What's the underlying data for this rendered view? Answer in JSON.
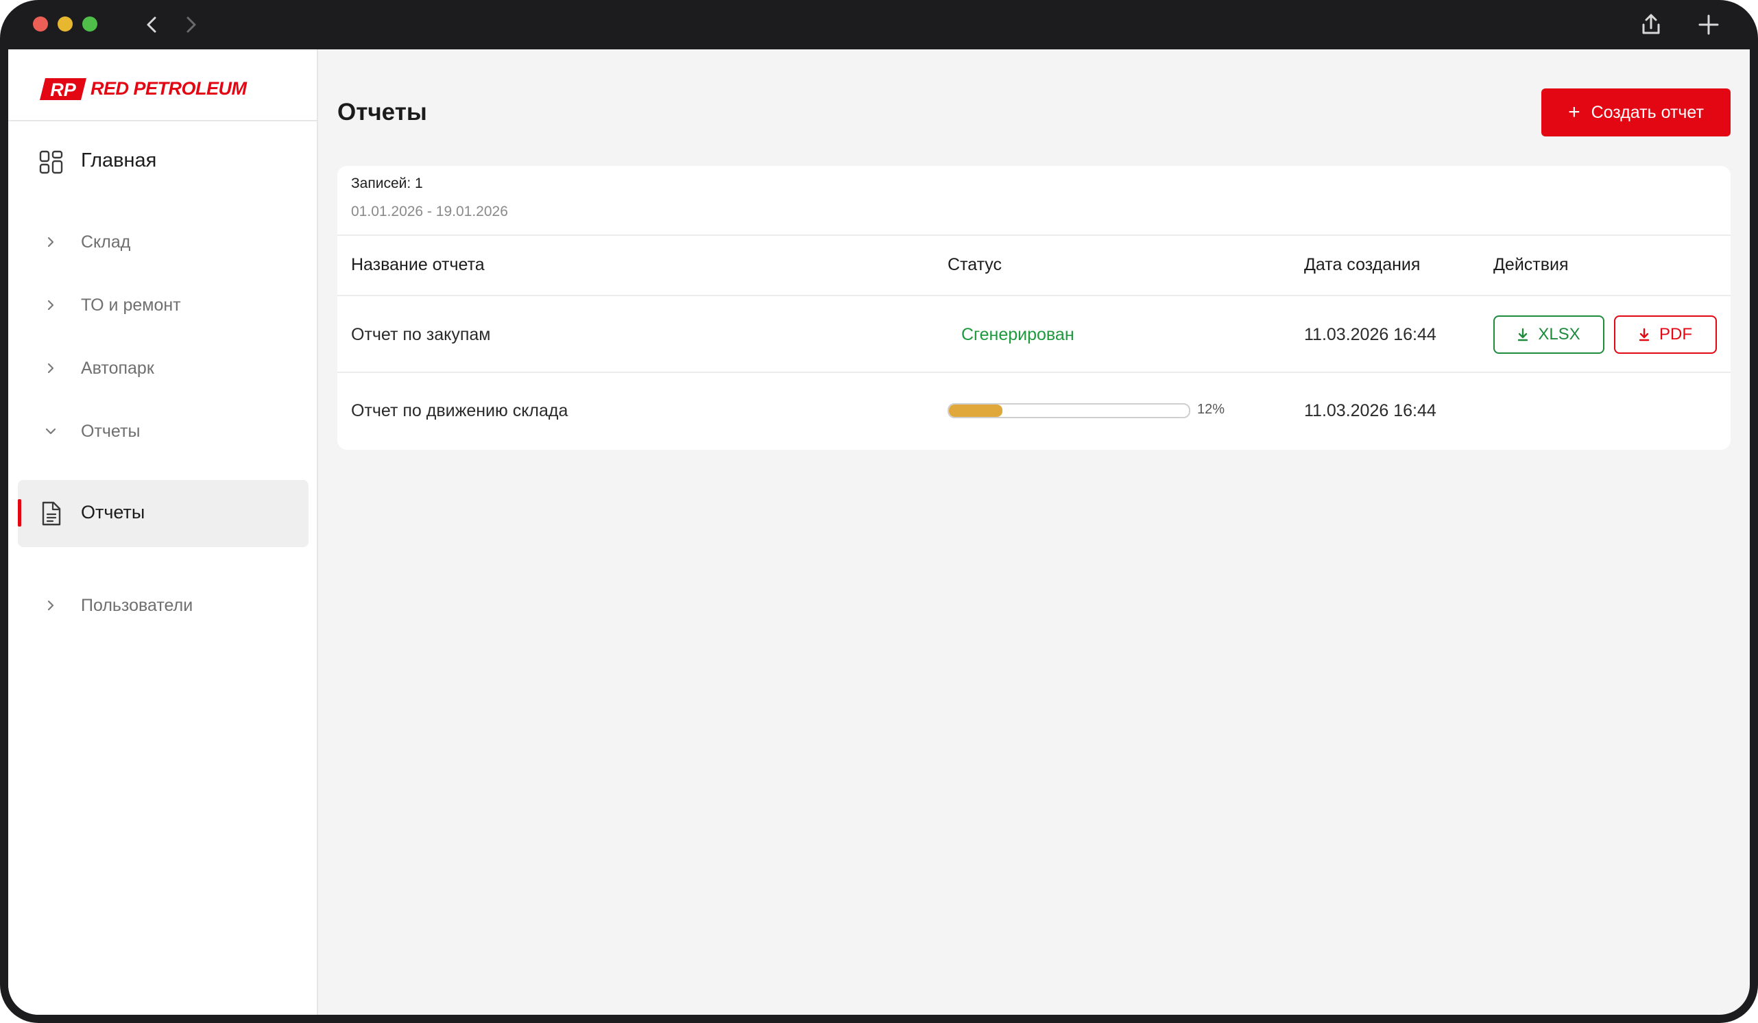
{
  "window": {
    "controls": [
      "close",
      "minimize",
      "maximize"
    ],
    "nav_icons": [
      "back-icon",
      "forward-icon"
    ],
    "right_icons": [
      "share-icon",
      "new-tab-icon"
    ]
  },
  "brand": {
    "logo_mark": "RP",
    "logo_text": "RED PETROLEUM",
    "color": "#e30613"
  },
  "sidebar": {
    "home": {
      "label": "Главная",
      "icon": "grid-icon"
    },
    "items": [
      {
        "label": "Склад",
        "icon": "chevron-right-icon"
      },
      {
        "label": "ТО и ремонт",
        "icon": "chevron-right-icon"
      },
      {
        "label": "Автопарк",
        "icon": "chevron-right-icon"
      },
      {
        "label": "Отчеты",
        "icon": "chevron-down-icon",
        "expanded": true
      },
      {
        "label": "Пользователи",
        "icon": "chevron-right-icon"
      }
    ],
    "active_sub": {
      "label": "Отчеты",
      "icon": "document-icon"
    }
  },
  "main": {
    "title": "Отчеты",
    "create_button": {
      "label": "Создать отчет",
      "icon": "plus-icon"
    },
    "summary": {
      "records": "Записей: 1",
      "date_range": "01.01.2026 - 19.01.2026"
    },
    "table": {
      "headers": [
        "Название отчета",
        "Статус",
        "Дата создания",
        "Действия"
      ],
      "rows": [
        {
          "name": "Отчет по закупам",
          "status": "Сгенерирован",
          "status_color": "#1e9a3c",
          "date": "11.03.2026 16:44",
          "actions": [
            {
              "label": "XLSX",
              "icon": "download-icon",
              "color": "#1e8a3c"
            },
            {
              "label": "PDF",
              "icon": "download-icon",
              "color": "#e30613"
            }
          ]
        },
        {
          "name": "Отчет по движению склада",
          "progress": 0.12,
          "progress_label": "12%",
          "progress_color": "#e0a83a",
          "date": "11.03.2026 16:44"
        }
      ]
    }
  }
}
